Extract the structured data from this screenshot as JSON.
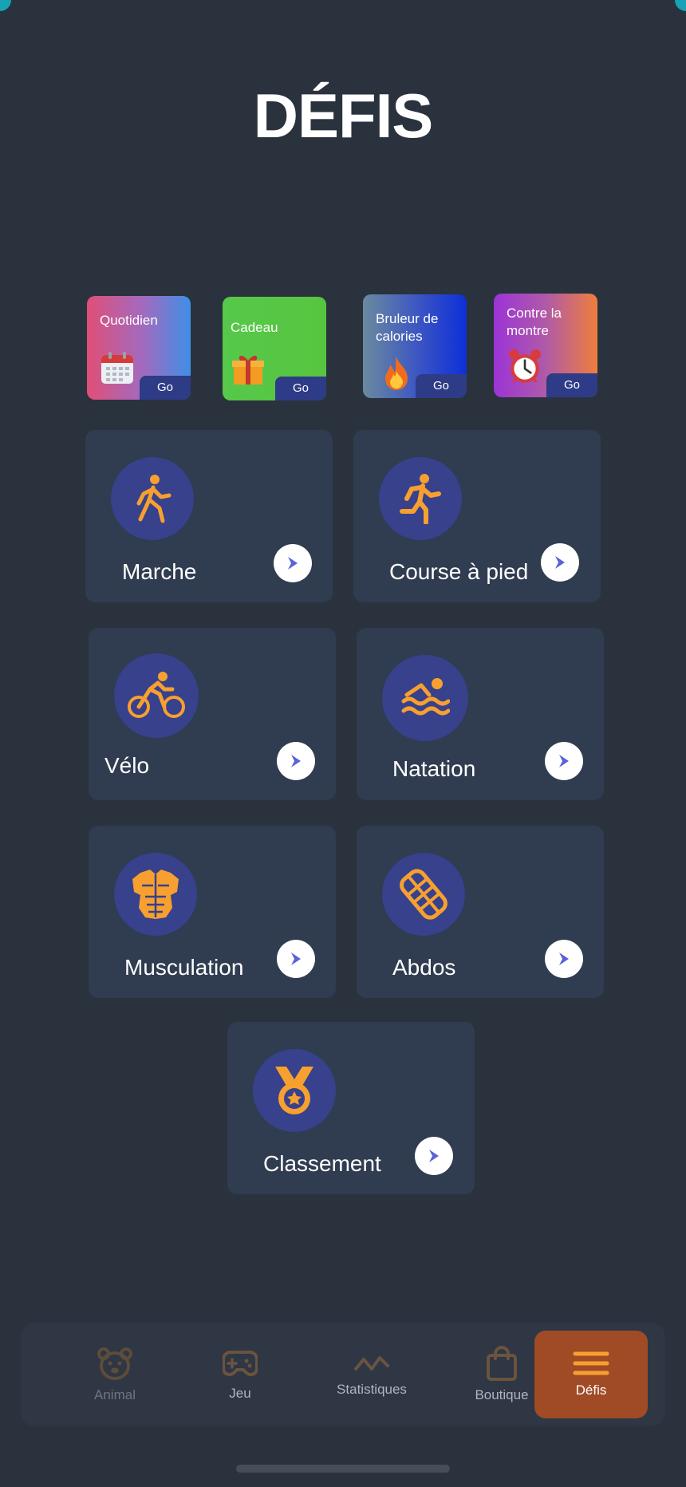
{
  "page": {
    "title": "DÉFIS"
  },
  "quick_tiles": [
    {
      "label": "Quotidien",
      "go": "Go",
      "icon": "calendar-icon"
    },
    {
      "label": "Cadeau",
      "go": "Go",
      "icon": "gift-icon"
    },
    {
      "label": "Bruleur de calories",
      "go": "Go",
      "icon": "fire-icon"
    },
    {
      "label": "Contre la montre",
      "go": "Go",
      "icon": "alarm-clock-icon"
    }
  ],
  "activities": [
    {
      "label": "Marche",
      "icon": "walking-icon"
    },
    {
      "label": "Course à pied",
      "icon": "running-icon"
    },
    {
      "label": "Vélo",
      "icon": "bicycle-icon"
    },
    {
      "label": "Natation",
      "icon": "swimming-icon"
    },
    {
      "label": "Musculation",
      "icon": "muscle-torso-icon"
    },
    {
      "label": "Abdos",
      "icon": "abs-icon"
    },
    {
      "label": "Classement",
      "icon": "medal-icon"
    }
  ],
  "nav": [
    {
      "label": "Animal",
      "icon": "pet-face-icon"
    },
    {
      "label": "Jeu",
      "icon": "gamepad-icon"
    },
    {
      "label": "Statistiques",
      "icon": "activity-chart-icon"
    },
    {
      "label": "Boutique",
      "icon": "shopping-bag-icon"
    },
    {
      "label": "Défis",
      "icon": "menu-icon"
    }
  ],
  "colors": {
    "background": "#2a323d",
    "card": "#303c50",
    "icon_circle": "#37418c",
    "accent_orange": "#f7a030",
    "arrow_blue": "#5b63d6",
    "nav_active": "#a04b25"
  }
}
